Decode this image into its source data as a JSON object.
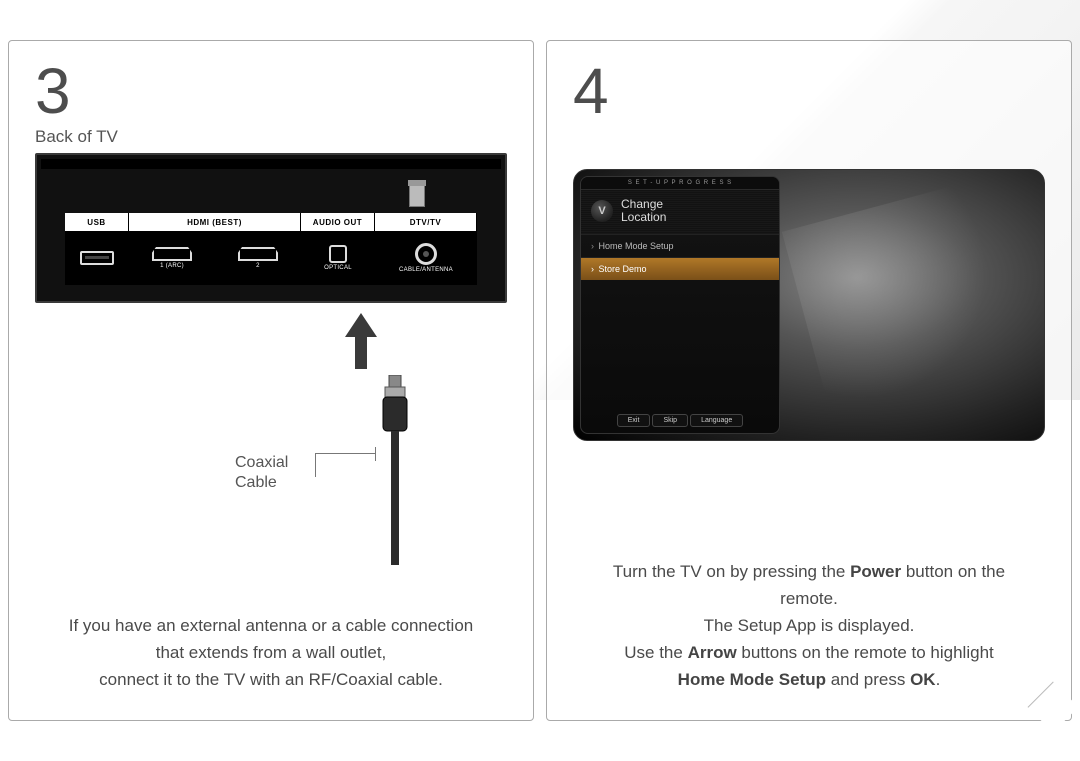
{
  "step3": {
    "number": "3",
    "subhead": "Back of TV",
    "ports": {
      "usb": "USB",
      "hdmi": "HDMI (BEST)",
      "audio": "AUDIO OUT",
      "dtv": "DTV/TV",
      "sub_1arc": "1 (ARC)",
      "sub_2": "2",
      "sub_optical": "OPTICAL",
      "sub_cable": "CABLE/ANTENNA"
    },
    "cable_label_1": "Coaxial",
    "cable_label_2": "Cable",
    "instr_line1": "If you have an external antenna or a cable connection",
    "instr_line2": "that extends from a wall outlet,",
    "instr_line3": "connect it to the TV with an RF/Coaxial cable."
  },
  "step4": {
    "number": "4",
    "osd": {
      "progress": "S E T - U P   P R O G R E S S",
      "title_line1": "Change",
      "title_line2": "Location",
      "item1": "Home Mode Setup",
      "item2": "Store Demo",
      "btn_exit": "Exit",
      "btn_skip": "Skip",
      "btn_lang": "Language"
    },
    "instr_l1a": "Turn the TV on by pressing the ",
    "instr_l1b": "Power",
    "instr_l1c": " button on the",
    "instr_l2": "remote.",
    "instr_l3": "The Setup App is displayed.",
    "instr_l4a": "Use the ",
    "instr_l4b": "Arrow",
    "instr_l4c": " buttons on the remote to highlight",
    "instr_l5a": "Home Mode Setup",
    "instr_l5b": " and press ",
    "instr_l5c": "OK",
    "instr_l5d": "."
  }
}
